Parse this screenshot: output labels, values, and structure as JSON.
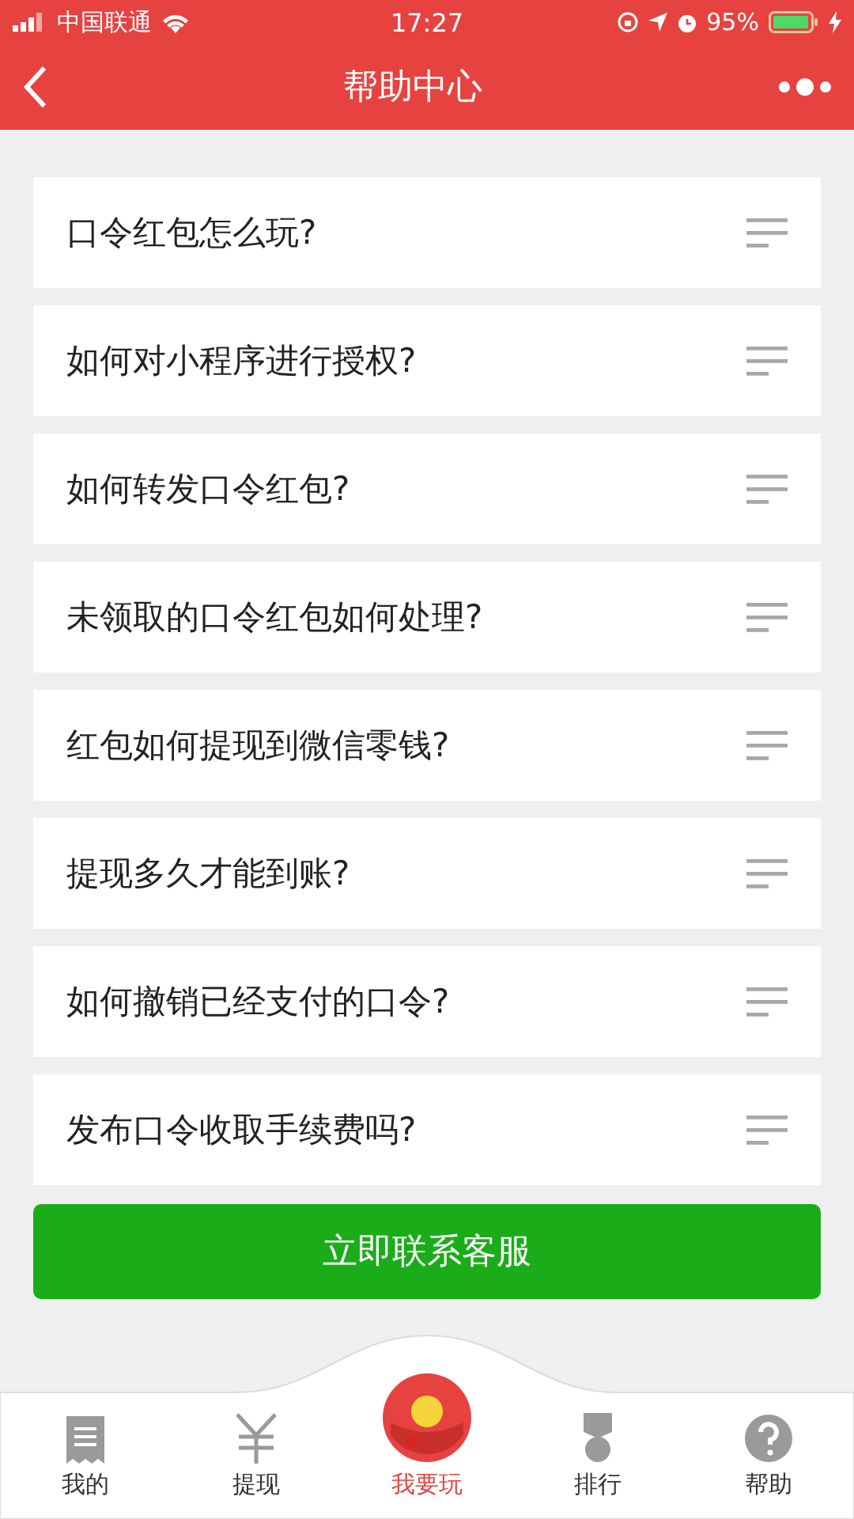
{
  "status_bar": {
    "carrier": "中国联通",
    "time": "17:27",
    "battery": "95%"
  },
  "nav": {
    "title": "帮助中心"
  },
  "questions": [
    {
      "text": "口令红包怎么玩?"
    },
    {
      "text": "如何对小程序进行授权?"
    },
    {
      "text": "如何转发口令红包?"
    },
    {
      "text": "未领取的口令红包如何处理?"
    },
    {
      "text": "红包如何提现到微信零钱?"
    },
    {
      "text": "提现多久才能到账?"
    },
    {
      "text": "如何撤销已经支付的口令?"
    },
    {
      "text": "发布口令收取手续费吗?"
    }
  ],
  "contact_button": "立即联系客服",
  "tabs": [
    {
      "label": "我的",
      "kind": "receipt",
      "selected": false
    },
    {
      "label": "提现",
      "kind": "yen",
      "selected": false
    },
    {
      "label": "我要玩",
      "kind": "redpacket",
      "selected": true
    },
    {
      "label": "排行",
      "kind": "medal",
      "selected": false
    },
    {
      "label": "帮助",
      "kind": "help",
      "selected": false
    }
  ]
}
